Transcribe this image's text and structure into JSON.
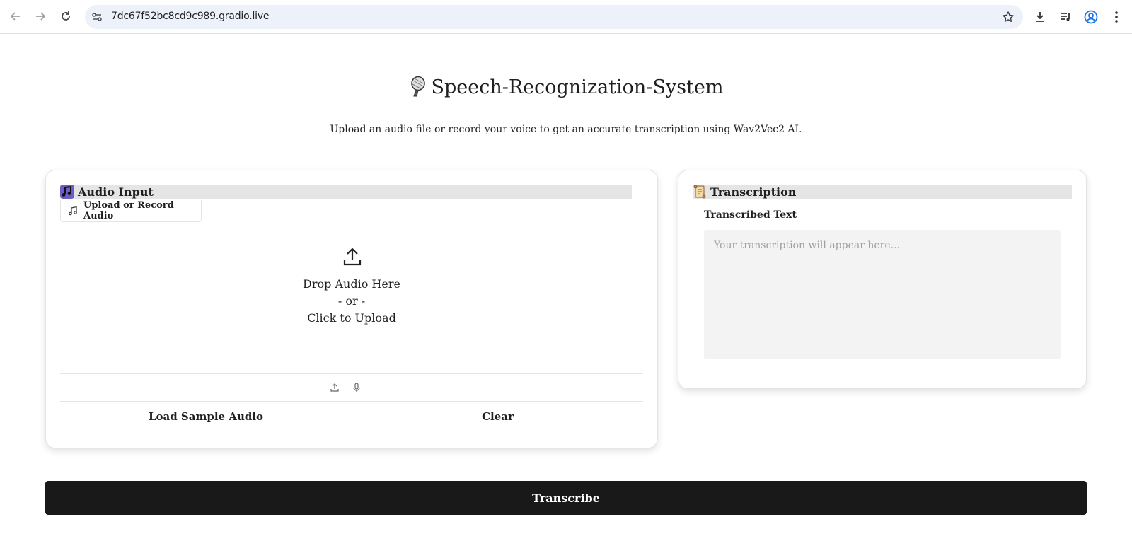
{
  "browser": {
    "url": "7dc67f52bc8cd9c989.gradio.live",
    "icons": [
      "back-icon",
      "forward-icon",
      "reload-icon",
      "site-info-icon",
      "bookmark-star-icon",
      "download-icon",
      "media-controls-icon",
      "profile-icon",
      "menu-icon"
    ]
  },
  "header": {
    "title": "Speech-Recognization-System",
    "subtitle": "Upload an audio file or record your voice to get an accurate transcription using Wav2Vec2 AI."
  },
  "audio_panel": {
    "heading": "Audio Input",
    "component_label": "Upload or Record Audio",
    "drop_line1": "Drop Audio Here",
    "drop_line2": "- or -",
    "drop_line3": "Click to Upload",
    "load_sample_label": "Load Sample Audio",
    "clear_label": "Clear"
  },
  "transcription_panel": {
    "heading": "Transcription",
    "field_label": "Transcribed Text",
    "placeholder": "Your transcription will appear here...",
    "value": ""
  },
  "transcribe_button": "Transcribe",
  "colors": {
    "primary_button": "#191919",
    "omnibox": "#edf1fa",
    "section_header": "#e5e5e5",
    "textbox_bg": "#f3f3f3"
  }
}
